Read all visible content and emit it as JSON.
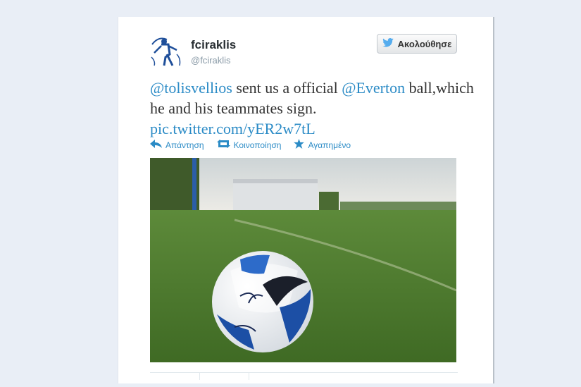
{
  "tweet": {
    "display_name": "fciraklis",
    "handle": "@fciraklis",
    "text": {
      "mention_1": "@tolisvellios",
      "part_1": " sent us a official ",
      "mention_2": "@Everton",
      "part_2": " ball,which he and his teammates sign.",
      "pic_link": "pic.twitter.com/yER2w7tL"
    }
  },
  "follow_button": {
    "label": "Ακολούθησε",
    "icon": "twitter-bird-icon"
  },
  "actions": [
    {
      "label": "Απάντηση",
      "icon": "reply-icon"
    },
    {
      "label": "Κοινοποίηση",
      "icon": "retweet-icon"
    },
    {
      "label": "Αγαπημένο",
      "icon": "star-icon"
    }
  ],
  "colors": {
    "link": "#2b8bc6",
    "text": "#333333",
    "handle": "#8899a6",
    "page_background": "#e9eef6"
  }
}
